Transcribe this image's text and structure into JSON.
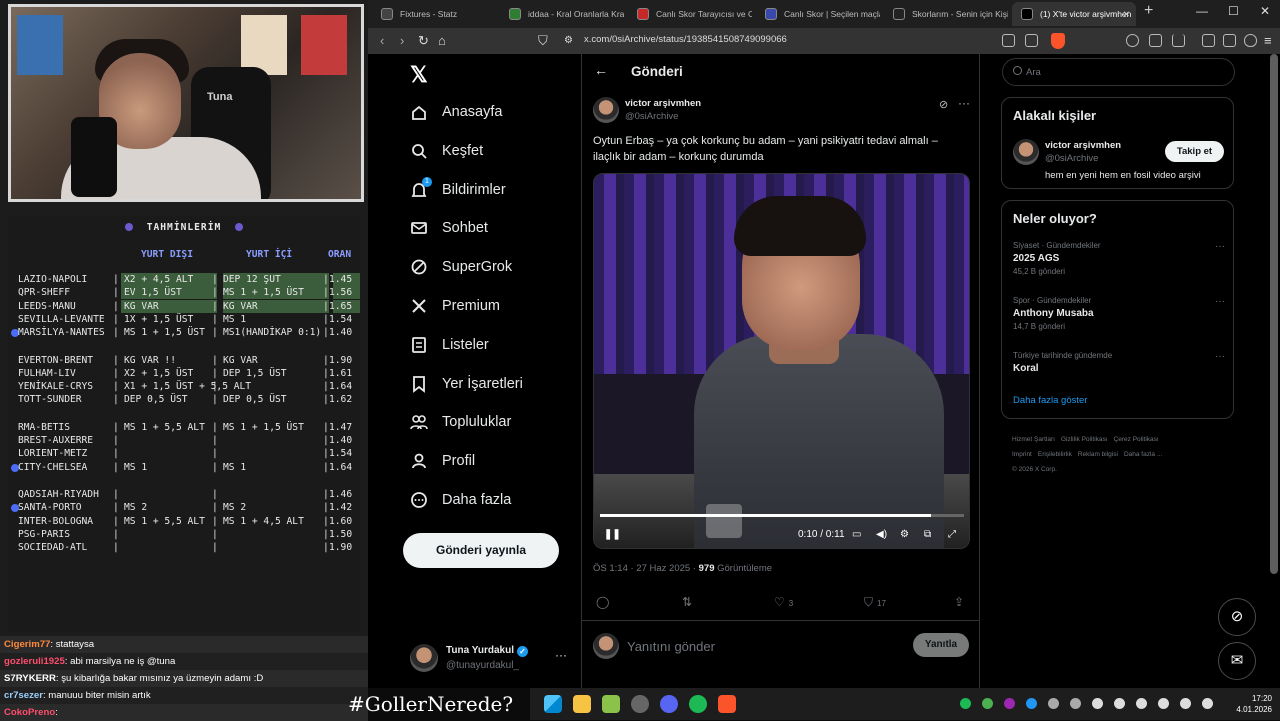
{
  "overlay": {
    "webcam": {
      "chair_brand": "Tuna"
    },
    "picks": {
      "title": "TAHMİNLERİM",
      "col_away": "YURT DIŞI",
      "col_home": "YURT İÇİ",
      "col_odds": "ORAN",
      "rows": [
        {
          "match": "LAZIO-NAPOLI",
          "away": "X2 + 4,5 ALT",
          "home": "DEP 12 ŞUT",
          "odds": "1.45"
        },
        {
          "match": "QPR-SHEFF",
          "away": "EV 1,5 ÜST",
          "home": "MS 1 + 1,5 ÜST",
          "odds": "1.56"
        },
        {
          "match": "LEEDS-MANU",
          "away": "KG VAR",
          "home": "KG VAR",
          "odds": "1.65"
        },
        {
          "match": "SEVILLA-LEVANTE",
          "away": "1X + 1,5 ÜST",
          "home": "MS 1",
          "odds": "1.54"
        },
        {
          "match": "MARSİLYA-NANTES",
          "away": "MS 1 + 1,5 ÜST",
          "home": "MS1(HANDİKAP 0:1)",
          "odds": "1.40"
        },
        {
          "match": "EVERTON-BRENT",
          "away": "KG VAR !!",
          "home": "KG VAR",
          "odds": "1.90"
        },
        {
          "match": "FULHAM-LIV",
          "away": "X2 + 1,5 ÜST",
          "home": "DEP 1,5 ÜST",
          "odds": "1.61"
        },
        {
          "match": "YENİKALE-CRYS",
          "away": "X1 + 1,5 ÜST + 5,5 ALT",
          "home": "",
          "odds": "1.64"
        },
        {
          "match": "TOTT-SUNDER",
          "away": "DEP 0,5 ÜST",
          "home": "DEP 0,5 ÜST",
          "odds": "1.62"
        },
        {
          "match": "RMA-BETIS",
          "away": "MS 1 + 5,5 ALT",
          "home": "MS 1 + 1,5 ÜST",
          "odds": "1.47"
        },
        {
          "match": "BREST-AUXERRE",
          "away": "",
          "home": "",
          "odds": "1.40"
        },
        {
          "match": "LORIENT-METZ",
          "away": "",
          "home": "",
          "odds": "1.54"
        },
        {
          "match": "CITY-CHELSEA",
          "away": "MS 1",
          "home": "MS 1",
          "odds": "1.64"
        },
        {
          "match": "QADSIAH-RIYADH",
          "away": "",
          "home": "",
          "odds": "1.46"
        },
        {
          "match": "SANTA-PORTO",
          "away": "MS 2",
          "home": "MS 2",
          "odds": "1.42"
        },
        {
          "match": "INTER-BOLOGNA",
          "away": "MS 1 + 5,5 ALT",
          "home": "MS 1 + 4,5 ALT",
          "odds": "1.60"
        },
        {
          "match": "PSG-PARIS",
          "away": "",
          "home": "",
          "odds": "1.50"
        },
        {
          "match": "SOCIEDAD-ATL",
          "away": "",
          "home": "",
          "odds": "1.90"
        }
      ]
    },
    "chat": [
      {
        "user": "Cigerim77",
        "msg": ": stattaysa",
        "color": "#ff8a3d"
      },
      {
        "user": "gozleruli1925",
        "msg": ": abi marsilya ne iş @tuna",
        "color": "#ff4d6d"
      },
      {
        "user": "S7RYKERR",
        "msg": ": şu kibarlığa bakar mısınız ya üzmeyin adamı :D",
        "color": "#ffffff"
      },
      {
        "user": "cr7sezer",
        "msg": ": manuuu biter misin artık",
        "color": "#9ad1ff"
      },
      {
        "user": "CokoPreno",
        "msg": ":",
        "color": "#ff4d6d"
      }
    ],
    "hashtag": "#GollerNerede?"
  },
  "browser": {
    "tabs": [
      {
        "label": "Fixtures - Statz",
        "color": "#444"
      },
      {
        "label": "iddaa - Kral Oranlarla Kralı",
        "color": "#2e7d32"
      },
      {
        "label": "Canlı Skor Tarayıcısı ve Can",
        "color": "#c62828"
      },
      {
        "label": "Canlı Skor | Seçilen maçlar",
        "color": "#3949ab"
      },
      {
        "label": "Skorlarım - Senin için Kişise",
        "color": "#222"
      },
      {
        "label": "(1) X'te victor arşivmhen",
        "color": "#000"
      }
    ],
    "new_tab": "+",
    "url": "x.com/0siArchive/status/1938541508749099066"
  },
  "xnav": {
    "logo": "𝕏",
    "items": [
      {
        "label": "Anasayfa",
        "icon": "home-icon"
      },
      {
        "label": "Keşfet",
        "icon": "search-icon"
      },
      {
        "label": "Bildirimler",
        "icon": "bell-icon"
      },
      {
        "label": "Sohbet",
        "icon": "mail-icon"
      },
      {
        "label": "SuperGrok",
        "icon": "grok-icon"
      },
      {
        "label": "Premium",
        "icon": "x-icon"
      },
      {
        "label": "Listeler",
        "icon": "list-icon"
      },
      {
        "label": "Yer İşaretleri",
        "icon": "bookmark-icon"
      },
      {
        "label": "Topluluklar",
        "icon": "people-icon"
      },
      {
        "label": "Profil",
        "icon": "person-icon"
      },
      {
        "label": "Daha fazla",
        "icon": "more-icon"
      }
    ],
    "notif_count": "1",
    "post_button": "Gönderi yayınla",
    "account": {
      "name": "Tuna Yurdakul",
      "handle": "@tunayurdakul_"
    }
  },
  "post": {
    "header_title": "Gönderi",
    "author_name": "victor arşivmhen",
    "author_handle": "@0siArchive",
    "text": "Oytun Erbaş – ya çok korkunç bu adam – yani psikiyatri tedavi almalı – ilaçlık bir adam – korkunç durumda",
    "video": {
      "time": "0:10 / 0:11",
      "progress": 0.91
    },
    "meta_time": "ÖS 1:14 · 27 Haz 2025 · ",
    "views": "979",
    "views_label": " Görüntüleme",
    "likes": "3",
    "bookmarks": "17",
    "reply_placeholder": "Yanıtını gönder",
    "reply_button": "Yanıtla"
  },
  "right": {
    "search_placeholder": "Ara",
    "related_title": "Alakalı kişiler",
    "related": {
      "name": "victor arşivmhen",
      "handle": "@0siArchive",
      "bio": "hem en yeni hem en fosil video arşivi",
      "follow": "Takip et"
    },
    "trends_title": "Neler oluyor?",
    "trends": [
      {
        "category": "Siyaset · Gündemdekiler",
        "name": "2025 AGS",
        "count": "45,2 B gönderi"
      },
      {
        "category": "Spor · Gündemdekiler",
        "name": "Anthony Musaba",
        "count": "14,7 B gönderi"
      },
      {
        "category": "Türkiye tarihinde gündemde",
        "name": "Koral",
        "count": ""
      }
    ],
    "show_more": "Daha fazla göster",
    "footer": [
      "Hizmet Şartları",
      "Gizlilik Politikası",
      "Çerez Politikası",
      "Imprint",
      "Erişilebilirlik",
      "Reklam bilgisi",
      "Daha fazla ...",
      "© 2026 X Corp."
    ]
  },
  "taskbar": {
    "time": "17:20",
    "date": "4.01.2026"
  }
}
